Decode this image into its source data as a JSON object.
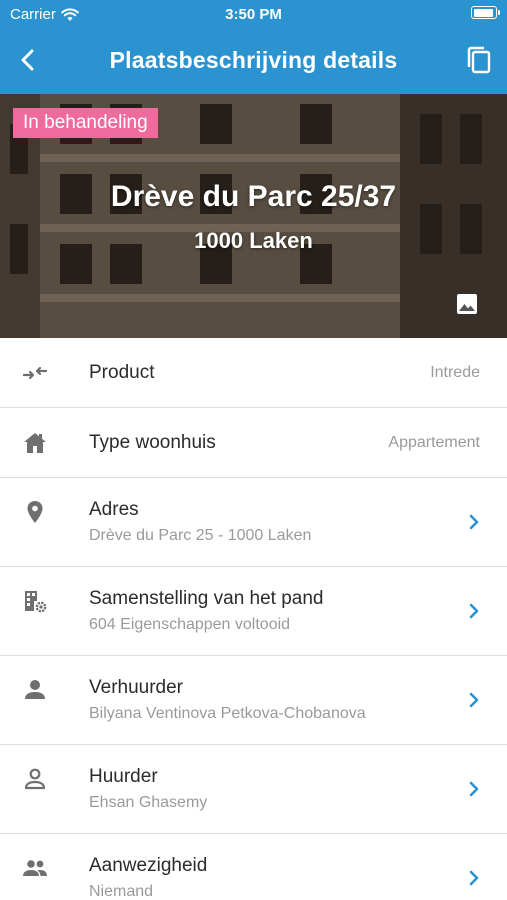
{
  "status_bar": {
    "carrier": "Carrier",
    "time": "3:50 PM"
  },
  "navbar": {
    "title": "Plaatsbeschrijving details",
    "back_icon": "chevron-left-icon",
    "copy_icon": "copy-icon"
  },
  "hero": {
    "badge": "In behandeling",
    "badge_color": "#ef6a9d",
    "title": "Drève du Parc 25/37",
    "subtitle": "1000 Laken",
    "image_icon": "image-icon"
  },
  "rows": [
    {
      "icon": "swap-arrows-icon",
      "label": "Product",
      "value": "Intrede"
    },
    {
      "icon": "house-icon",
      "label": "Type woonhuis",
      "value": "Appartement"
    },
    {
      "icon": "location-pin-icon",
      "label": "Adres",
      "sub": "Drève du Parc 25 - 1000 Laken"
    },
    {
      "icon": "building-settings-icon",
      "label": "Samenstelling van het pand",
      "sub": "604 Eigenschappen voltooid"
    },
    {
      "icon": "person-icon",
      "label": "Verhuurder",
      "sub": "Bilyana Ventinova Petkova-Chobanova"
    },
    {
      "icon": "person-outline-icon",
      "label": "Huurder",
      "sub": "Ehsan Ghasemy"
    },
    {
      "icon": "people-icon",
      "label": "Aanwezigheid",
      "sub": "Niemand"
    }
  ],
  "colors": {
    "primary": "#2b93cf",
    "chevron": "#2b93cf",
    "icon_gray": "#6f6f6f"
  }
}
